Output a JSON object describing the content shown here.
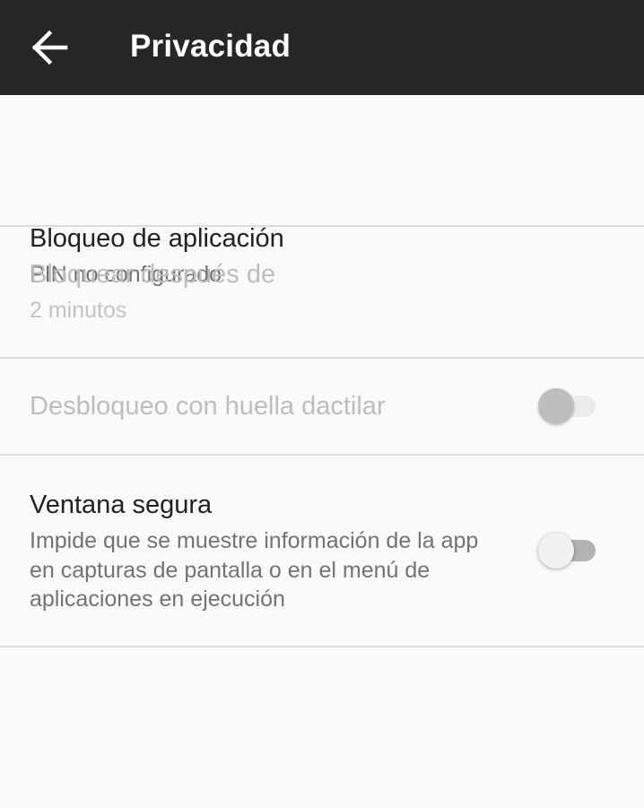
{
  "appbar": {
    "back_icon": "arrow-back-icon",
    "title": "Privacidad"
  },
  "settings": {
    "app_lock": {
      "title": "Bloqueo de aplicación",
      "summary": "PIN no configurado"
    },
    "lock_after": {
      "title": "Bloquear después de",
      "summary": "2 minutos",
      "enabled": false
    },
    "fingerprint_unlock": {
      "title": "Desbloqueo con huella dactilar",
      "enabled": false,
      "checked": false
    },
    "secure_window": {
      "title": "Ventana segura",
      "summary": "Impide que se muestre información de la app en capturas de pantalla o en el menú de aplicaciones en ejecución",
      "checked": false
    }
  },
  "colors": {
    "appbar_bg": "#262626",
    "page_bg": "#fafafa",
    "divider": "#dcdcdc",
    "text_primary": "#212121",
    "text_secondary": "#737373",
    "text_disabled": "#bdbdbd"
  }
}
